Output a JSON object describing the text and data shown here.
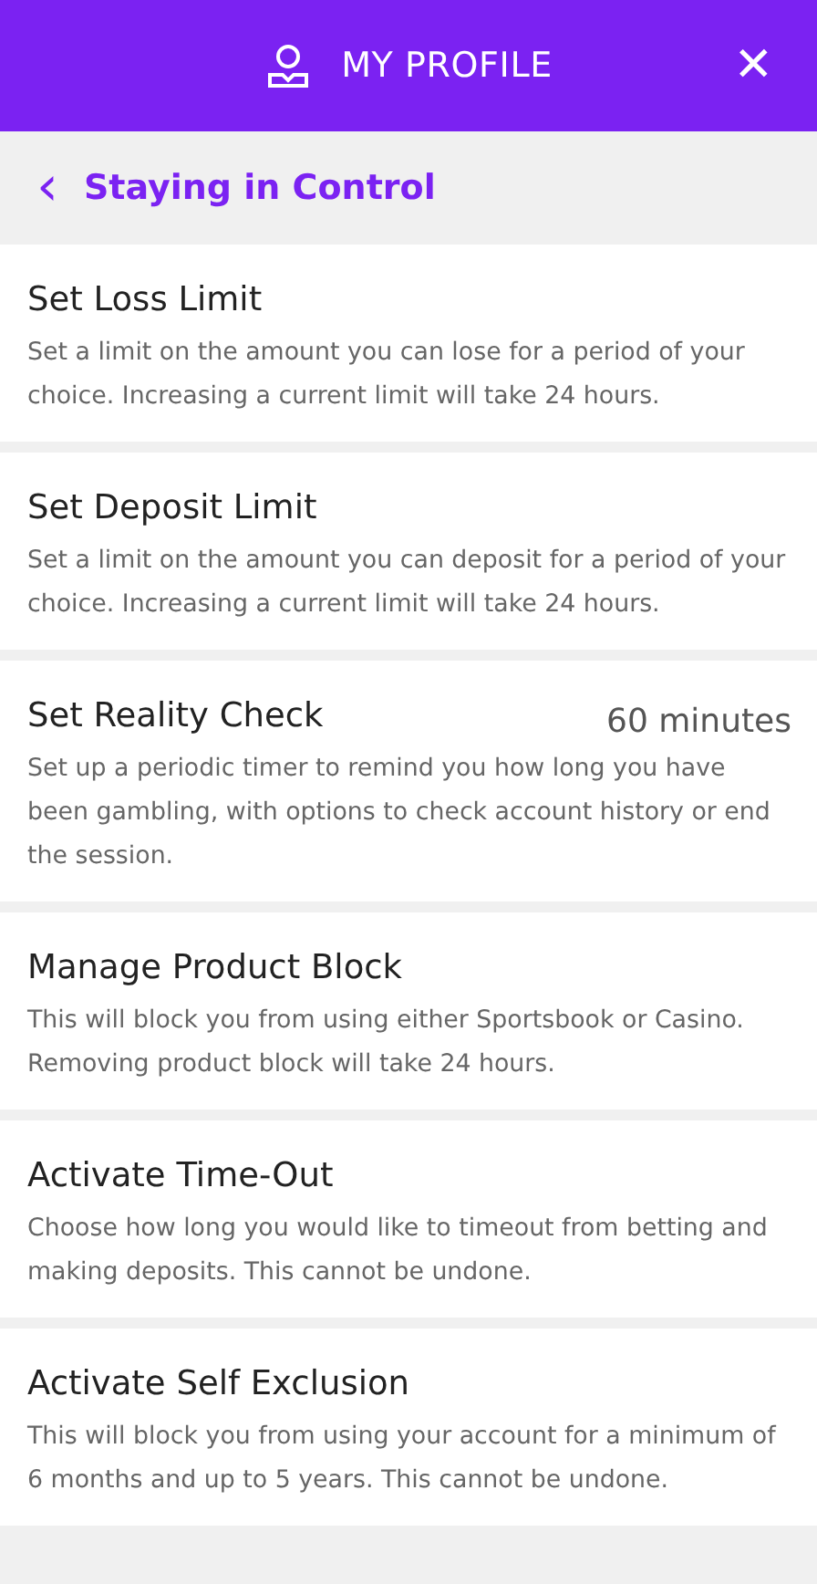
{
  "header": {
    "title": "MY PROFILE",
    "close": "✕"
  },
  "subheader": {
    "back": "‹",
    "title": "Staying in Control"
  },
  "items": [
    {
      "title": "Set Loss Limit",
      "description": "Set a limit on the amount you can lose for a period of your choice. Increasing a current limit will take 24 hours."
    },
    {
      "title": "Set Deposit Limit",
      "description": "Set a limit on the amount you can deposit for a period of your choice. Increasing a current limit will take 24 hours."
    },
    {
      "title": "Set Reality Check",
      "value": "60 minutes",
      "description": "Set up a periodic timer to remind you how long you have been gambling, with options to check account history or end the session."
    },
    {
      "title": "Manage Product Block",
      "description": "This will block you from using either Sportsbook or Casino. Removing product block will take 24 hours."
    },
    {
      "title": "Activate Time-Out",
      "description": "Choose how long you would like to timeout from betting and making deposits. This cannot be undone."
    },
    {
      "title": "Activate Self Exclusion",
      "description": "This will block you from using your account for a minimum of 6 months and up to 5 years. This cannot be undone."
    }
  ]
}
